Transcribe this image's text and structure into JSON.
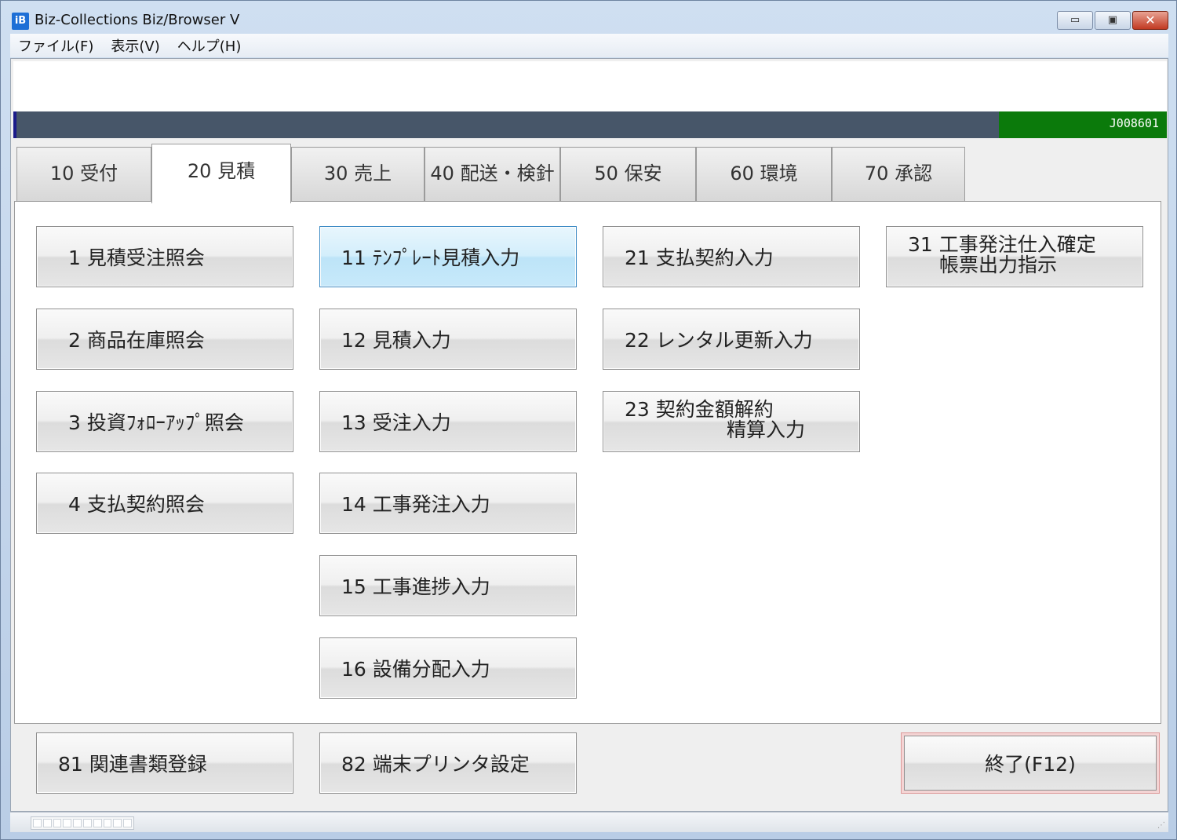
{
  "window": {
    "icon_text": "iB",
    "title": "Biz-Collections Biz/Browser V",
    "controls": {
      "minimize": "▭",
      "maximize": "▣",
      "close": "✕"
    }
  },
  "menu": [
    "ファイル(F)",
    "表示(V)",
    "ヘルプ(H)"
  ],
  "header": {
    "code": "J008601"
  },
  "tabs": [
    {
      "label": "10 受付",
      "active": false
    },
    {
      "label": "20 見積",
      "active": true
    },
    {
      "label": "30 売上",
      "active": false
    },
    {
      "label": "40 配送・検針",
      "active": false
    },
    {
      "label": "50 保安",
      "active": false
    },
    {
      "label": "60 環境",
      "active": false
    },
    {
      "label": "70 承認",
      "active": false
    }
  ],
  "buttons": {
    "b1": "1 見積受注照会",
    "b2": "2 商品在庫照会",
    "b3": "3 投資ﾌｫﾛｰｱｯﾌﾟ照会",
    "b4": "4 支払契約照会",
    "b11": "11 ﾃﾝﾌﾟﾚｰﾄ見積入力",
    "b12": "12 見積入力",
    "b13": "13 受注入力",
    "b14": "14 工事発注入力",
    "b15": "15 工事進捗入力",
    "b16": "16 設備分配入力",
    "b21": "21 支払契約入力",
    "b22": "22 レンタル更新入力",
    "b23_line1": "23 契約金額解約",
    "b23_line2": "精算入力",
    "b31_line1": "31 工事発注仕入確定",
    "b31_line2": "帳票出力指示",
    "b81": "81 関連書類登録",
    "b82": "82 端末プリンタ設定",
    "exit": "終了(F12)"
  }
}
